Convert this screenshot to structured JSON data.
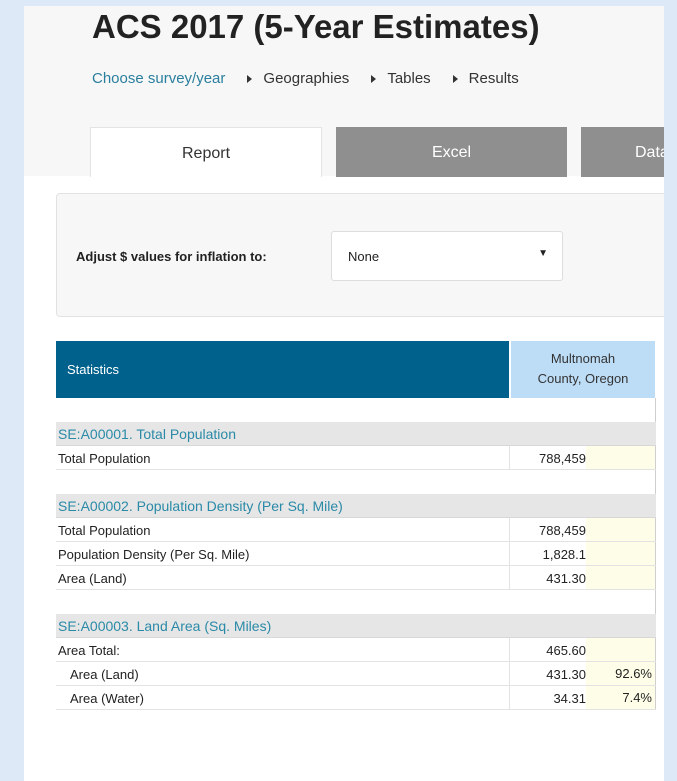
{
  "header": {
    "title": "ACS 2017 (5-Year Estimates)",
    "breadcrumbs": [
      "Choose survey/year",
      "Geographies",
      "Tables",
      "Results"
    ]
  },
  "tabs": [
    {
      "label": "Report",
      "active": true
    },
    {
      "label": "Excel",
      "active": false
    },
    {
      "label": "Data",
      "active": false
    }
  ],
  "inflation": {
    "label": "Adjust $ values for inflation to:",
    "selected": "None"
  },
  "table": {
    "stats_header": "Statistics",
    "geo_header_line1": "Multnomah",
    "geo_header_line2": "County, Oregon",
    "sections": [
      {
        "title": "SE:A00001. Total Population",
        "rows": [
          {
            "label": "Total Population",
            "value": "788,459",
            "pct": ""
          }
        ]
      },
      {
        "title": "SE:A00002. Population Density (Per Sq. Mile)",
        "rows": [
          {
            "label": "Total Population",
            "value": "788,459",
            "pct": ""
          },
          {
            "label": "Population Density (Per Sq. Mile)",
            "value": "1,828.1",
            "pct": ""
          },
          {
            "label": "Area (Land)",
            "value": "431.30",
            "pct": ""
          }
        ]
      },
      {
        "title": "SE:A00003. Land Area (Sq. Miles)",
        "rows": [
          {
            "label": "Area Total:",
            "value": "465.60",
            "pct": ""
          },
          {
            "label": "Area (Land)",
            "value": "431.30",
            "pct": "92.6%",
            "indent": true
          },
          {
            "label": "Area (Water)",
            "value": "34.31",
            "pct": "7.4%",
            "indent": true
          }
        ]
      }
    ]
  }
}
